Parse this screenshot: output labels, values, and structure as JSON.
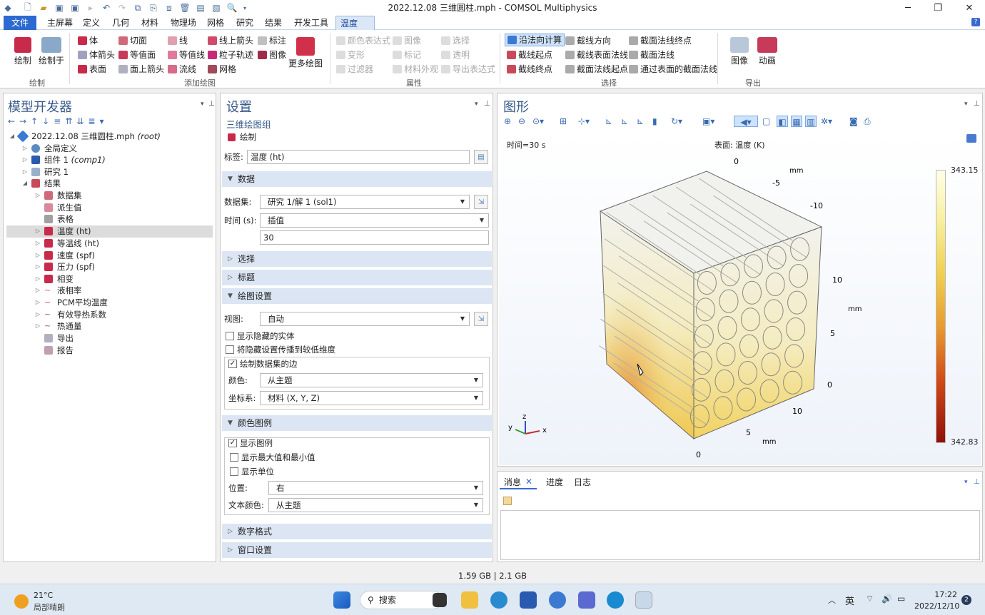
{
  "window": {
    "title": "2022.12.08 三维圆柱.mph - COMSOL Multiphysics"
  },
  "menu": [
    "文件",
    "主屏幕",
    "定义",
    "几何",
    "材料",
    "物理场",
    "网格",
    "研究",
    "结果",
    "开发工具",
    "温度 (ht)"
  ],
  "ribbon": {
    "plot_group": {
      "plot": "绘制",
      "plot_in": "绘制于",
      "label": "绘制"
    },
    "add_plot": {
      "items": [
        "体",
        "切面",
        "线",
        "线上箭头",
        "标注",
        "体箭头",
        "等值面",
        "等值线",
        "粒子轨迹",
        "图像",
        "表面",
        "面上箭头",
        "流线",
        "网格"
      ],
      "more": "更多绘图",
      "label": "添加绘图"
    },
    "attributes": {
      "items": [
        "颜色表达式",
        "图像",
        "选择",
        "变形",
        "标记",
        "透明",
        "过滤器",
        "材料外观",
        "导出表达式"
      ],
      "label": "属性"
    },
    "selection": {
      "items": [
        "沿法向计算",
        "截线方向",
        "截面法线终点",
        "截线起点",
        "截线表面法线",
        "截面法线",
        "截线终点",
        "截面法线起点",
        "通过表面的截面法线"
      ],
      "label": "选择"
    },
    "export": {
      "image": "图像",
      "animation": "动画",
      "label": "导出"
    }
  },
  "model_builder": {
    "title": "模型开发器",
    "tree": [
      {
        "label": "2022.12.08 三维圆柱.mph",
        "suffix": "(root)"
      },
      {
        "label": "全局定义"
      },
      {
        "label": "组件 1",
        "suffix": "(comp1)"
      },
      {
        "label": "研究 1"
      },
      {
        "label": "结果"
      },
      {
        "label": "数据集"
      },
      {
        "label": "派生值"
      },
      {
        "label": "表格"
      },
      {
        "label": "温度 (ht)"
      },
      {
        "label": "等温线 (ht)"
      },
      {
        "label": "速度 (spf)"
      },
      {
        "label": "压力 (spf)"
      },
      {
        "label": "相变"
      },
      {
        "label": "液相率"
      },
      {
        "label": "PCM平均温度"
      },
      {
        "label": "有效导热系数"
      },
      {
        "label": "热通量"
      },
      {
        "label": "导出"
      },
      {
        "label": "报告"
      }
    ]
  },
  "settings": {
    "title": "设置",
    "subtitle": "三维绘图组",
    "plot_link": "绘制",
    "label_label": "标签:",
    "label_value": "温度 (ht)",
    "sec_data": "数据",
    "dataset_label": "数据集:",
    "dataset_value": "研究 1/解 1 (sol1)",
    "time_label": "时间 (s):",
    "time_value": "插值",
    "time_input": "30",
    "sec_selection": "选择",
    "sec_title": "标题",
    "sec_plot_settings": "绘图设置",
    "view_label": "视图:",
    "view_value": "自动",
    "cb_hidden": "显示隐藏的实体",
    "cb_propagate": "将隐藏设置传播到较低维度",
    "cb_edges": "绘制数据集的边",
    "color_label": "颜色:",
    "color_value": "从主题",
    "coord_label": "坐标系:",
    "coord_value": "材料 (X, Y, Z)",
    "sec_legend": "颜色图例",
    "cb_show_legend": "显示图例",
    "cb_show_maxmin": "显示最大值和最小值",
    "cb_show_units": "显示单位",
    "pos_label": "位置:",
    "pos_value": "右",
    "textcolor_label": "文本颜色:",
    "textcolor_value": "从主题",
    "sec_number": "数字格式",
    "sec_window": "窗口设置"
  },
  "graphics": {
    "title": "图形",
    "time": "时间=30 s",
    "surface": "表面: 温度 (K)",
    "max": "343.15",
    "min": "342.83",
    "axis_ticks": [
      "0",
      "mm",
      "-5",
      "-10",
      "10",
      "mm",
      "5",
      "0",
      "10",
      "5",
      "mm",
      "0"
    ],
    "triad": {
      "z": "z",
      "y": "y",
      "x": "x"
    }
  },
  "messages": {
    "tabs": [
      "消息",
      "进度",
      "日志"
    ]
  },
  "status": {
    "memory": "1.59 GB | 2.1 GB"
  },
  "taskbar": {
    "temp": "21°C",
    "weather": "局部晴朗",
    "search": "搜索",
    "lang": "英",
    "time": "17:22",
    "date": "2022/12/10",
    "badge": "2"
  }
}
